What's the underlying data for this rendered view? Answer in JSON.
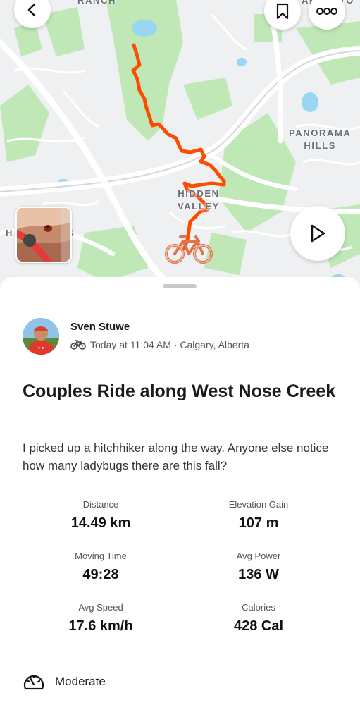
{
  "map": {
    "labels": [
      "RANCH",
      "AR",
      "TO",
      "PANORAMA\nHILLS",
      "HIDDEN\nVALLEY",
      "H",
      "S"
    ]
  },
  "toolbar": {
    "back_icon": "chevron-left-icon",
    "bookmark_icon": "bookmark-icon",
    "more_icon": "more-horizontal-icon",
    "play_icon": "play-icon"
  },
  "activity": {
    "athlete_name": "Sven Stuwe",
    "sport_icon": "bike-icon",
    "meta": "Today at 11:04 AM · Calgary, Alberta",
    "title": "Couples Ride along West Nose Creek",
    "description": "I picked up a hitchhiker along the way. Anyone else notice how many ladybugs there are this fall?",
    "stats": [
      {
        "label": "Distance",
        "value": "14.49 km"
      },
      {
        "label": "Elevation Gain",
        "value": "107 m"
      },
      {
        "label": "Moving Time",
        "value": "49:28"
      },
      {
        "label": "Avg Power",
        "value": "136 W"
      },
      {
        "label": "Avg Speed",
        "value": "17.6 km/h"
      },
      {
        "label": "Calories",
        "value": "428 Cal"
      }
    ],
    "effort_icon": "gauge-icon",
    "effort": "Moderate"
  },
  "colors": {
    "route": "#fc4c02",
    "park": "#b8e6b0",
    "water": "#8ed0f0"
  }
}
